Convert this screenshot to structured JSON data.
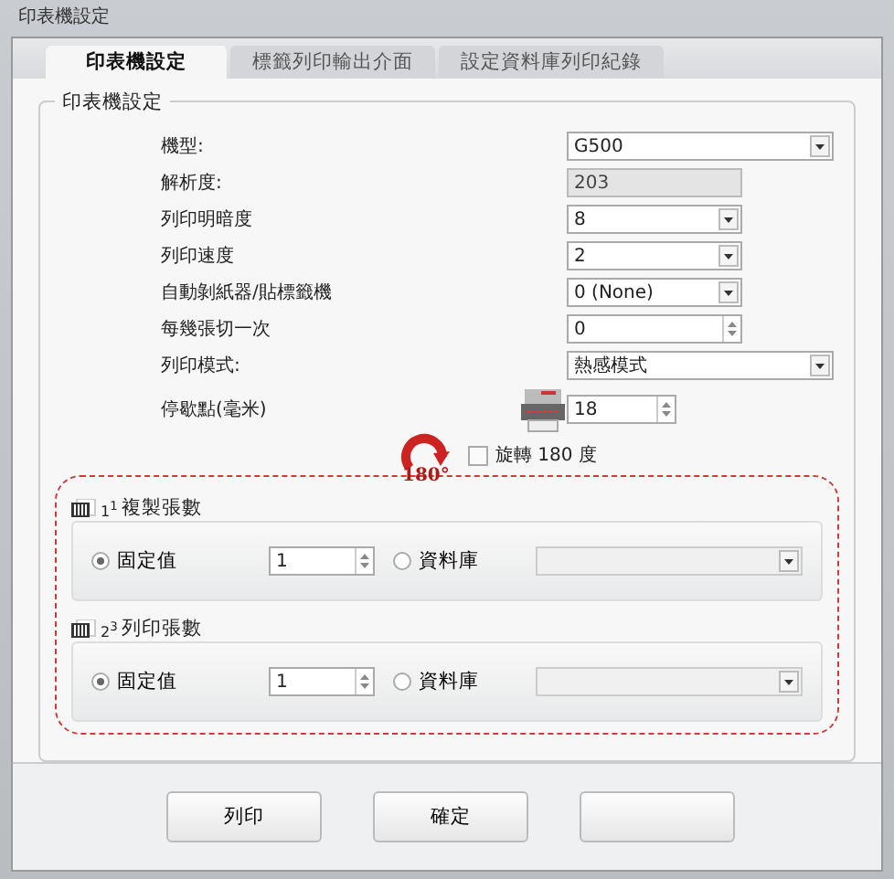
{
  "window": {
    "title": "印表機設定"
  },
  "tabs": [
    {
      "label": "印表機設定",
      "selected": true
    },
    {
      "label": "標籤列印輸出介面",
      "selected": false
    },
    {
      "label": "設定資料庫列印紀錄",
      "selected": false
    }
  ],
  "group": {
    "title": "印表機設定"
  },
  "settings": [
    {
      "label": "機型:",
      "kind": "combo",
      "value": "G500"
    },
    {
      "label": "解析度:",
      "kind": "readonly",
      "value": "203"
    },
    {
      "label": "列印明暗度",
      "kind": "combo",
      "value": "8"
    },
    {
      "label": "列印速度",
      "kind": "combo",
      "value": "2"
    },
    {
      "label": "自動剝紙器/貼標籤機",
      "kind": "combo",
      "value": "0 (None)"
    },
    {
      "label": "每幾張切一次",
      "kind": "spin",
      "value": "0"
    },
    {
      "label": "列印模式:",
      "kind": "combo",
      "value": "熱感模式"
    },
    {
      "label": "停歇點(毫米)",
      "kind": "spin-printer",
      "value": "18"
    }
  ],
  "rotate": {
    "badge": "180°",
    "label": "旋轉 180 度",
    "checked": false
  },
  "sections": [
    {
      "marker": "1$^{1}$",
      "title": "複製張數",
      "options": [
        {
          "label": "固定值",
          "selected": true
        },
        {
          "label": "資料庫",
          "selected": false
        }
      ],
      "value": "1"
    },
    {
      "marker": "2$^{3}$",
      "title": "列印張數",
      "options": [
        {
          "label": "固定值",
          "selected": true
        },
        {
          "label": "資料庫",
          "selected": false
        }
      ],
      "value": "1"
    }
  ],
  "buttons": [
    {
      "kind": "labeled",
      "label": "列印"
    },
    {
      "kind": "labeled",
      "label": "確定"
    },
    {
      "kind": "covered"
    }
  ]
}
